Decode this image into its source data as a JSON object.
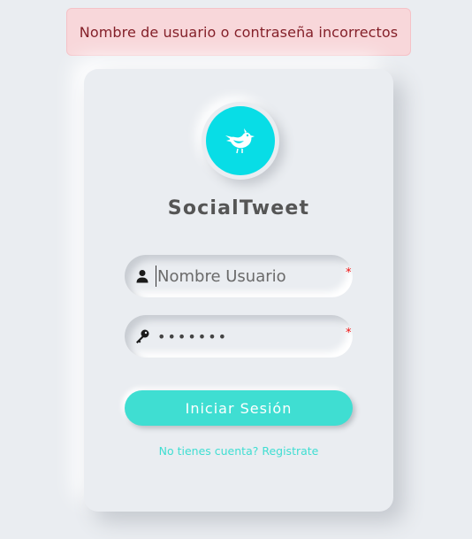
{
  "alert": {
    "text": "Nombre de usuario o contraseña incorrectos"
  },
  "app": {
    "name": "SocialTweet",
    "logo_icon": "bird-icon"
  },
  "form": {
    "username": {
      "value": "",
      "placeholder": "Nombre Usuario",
      "icon": "user-icon",
      "required_mark": "*"
    },
    "password": {
      "value": "•••••••",
      "icon": "key-icon",
      "required_mark": "*"
    },
    "submit_label": "Iniciar Sesión",
    "signup_link": "No tienes cuenta? Registrate"
  },
  "colors": {
    "accent": "#3fded2",
    "logo_bg": "#08dde6",
    "alert_bg": "#f8d7da",
    "alert_text": "#842029",
    "background": "#eaedf1",
    "required": "#ee1111"
  }
}
